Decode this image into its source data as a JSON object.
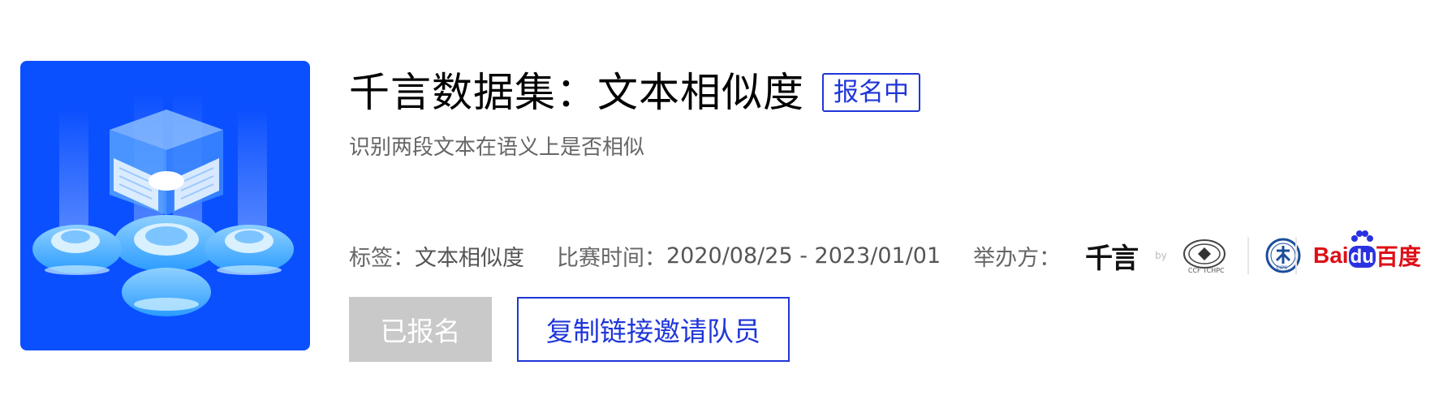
{
  "competition": {
    "title": "千言数据集：文本相似度",
    "status_badge": "报名中",
    "subtitle": "识别两段文本在语义上是否相似"
  },
  "meta": {
    "tags_label": "标签：",
    "tags_value": "文本相似度",
    "time_label": "比赛时间：",
    "time_value": "2020/08/25 - 2023/01/01",
    "organizer_label": "举办方："
  },
  "organizers": {
    "qianyan_text": "千言",
    "by_text": "by",
    "ccf_text": "CCF TCHPC",
    "cips_text": "CIPS",
    "baidu_bai": "Bai",
    "baidu_du": "du",
    "baidu_cn": "百度"
  },
  "buttons": {
    "registered_label": "已报名",
    "invite_label": "复制链接邀请队员"
  },
  "colors": {
    "accent": "#1f36d8",
    "cover_bg": "#0b50ff",
    "disabled_button": "#c9c9c9",
    "baidu_red": "#de0f17",
    "baidu_blue": "#2932e1"
  }
}
